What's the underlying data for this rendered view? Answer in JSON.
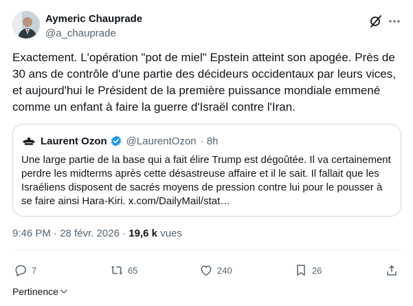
{
  "post": {
    "author_name": "Aymeric Chauprade",
    "author_handle": "@a_chauprade",
    "text": "Exactement. L'opération \"pot de miel\" Epstein atteint son apogée. Près de 30 ans de contrôle d'une partie des décideurs occidentaux par leurs vices, et aujourd'hui le Président de la première puissance mondiale emmené comme un enfant à faire la guerre d'Israël contre l'Iran.",
    "time": "9:46 PM",
    "separator": "·",
    "date": "28 févr. 2026",
    "views_count": "19,6 k",
    "views_label": "vues"
  },
  "quote": {
    "author_name": "Laurent Ozon",
    "author_handle": "@LaurentOzon",
    "age": "· 8h",
    "text": "Une large partie de la base qui a fait élire Trump est dégoûtée. Il va certainement perdre les midterms après cette désastreuse affaire et il le sait. Il fallait que les Israéliens disposent de sacrés moyens de pression contre lui pour le pousser à se faire ainsi Hara-Kiri. x.com/DailyMail/stat…",
    "verified_color": "#1d9bf0"
  },
  "actions": {
    "replies": "7",
    "reposts": "65",
    "likes": "240",
    "bookmarks": "26"
  },
  "sort": {
    "label": "Pertinence"
  },
  "colors": {
    "text": "#0f1419",
    "secondary": "#536471",
    "border": "#cfd9de",
    "accent": "#1d9bf0"
  }
}
